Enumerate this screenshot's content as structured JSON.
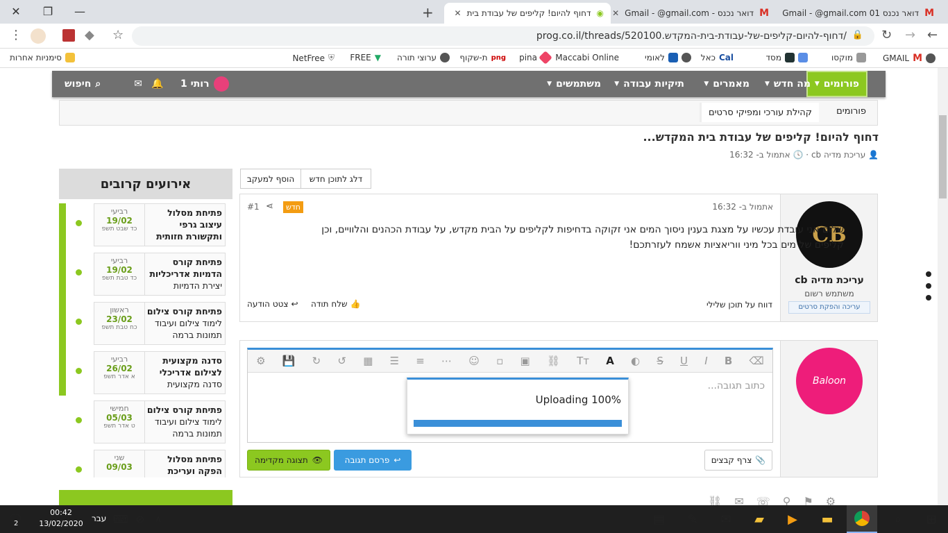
{
  "browser": {
    "tabs": [
      {
        "title": "דחוף להיום! קליפים של עבודת בית",
        "active": true
      },
      {
        "title": "דואר נכנס - Gmail - @gmail.com",
        "active": false
      },
      {
        "title": "דואר נכנס Gmail - @gmail.com 01",
        "active": false
      }
    ],
    "url": "prog.co.il/threads/520100.דחוף-להיום-קליפים-של-עבודת-בית-המקדש/",
    "bookmarks": [
      "GMAIL",
      "מוקסו",
      "מסד",
      "כאל",
      "לאומי",
      "Maccabi Online",
      "pina",
      "ת-שקוף",
      "ערוצי תורה",
      "FREE",
      "NetFree",
      "סימניות אחרות"
    ]
  },
  "nav": {
    "items": [
      "פורומים",
      "מה חדש",
      "מאמרים",
      "תיקיות עבודה",
      "משתמשים"
    ],
    "user": "רותי 1",
    "search": "חיפוש"
  },
  "breadcrumb": [
    "פורומים",
    "קהילת עורכי ומפיקי סרטים"
  ],
  "thread": {
    "title": "דחוף להיום! קליפים של עבודת בית המקדש...",
    "author": "עריכת מדיה cb",
    "time": "אתמול ב- 16:32",
    "btn_watch": "הוסף למעקב",
    "btn_new": "דלג לתוכן חדש"
  },
  "post": {
    "username": "עריכת מדיה cb",
    "usertitle": "משתמש רשום",
    "userbanner": "עריכה והפקת סרטים",
    "time": "אתמול ב- 16:32",
    "badge": "חדש",
    "number": "#1",
    "body": "שלום אני עובדת עכשיו על מצגת בענין ניסוך המים אני זקוקה בדחיפות לקליפים על הבית מקדש, על עבודת הכהנים והלוויים, וכן קליפים של מים בכל מיני ווריאציות אשמח לעזרתכם!",
    "report": "דווח על תוכן שלילי",
    "thanks": "שלח תודה",
    "quote": "צטט הודעה"
  },
  "reply": {
    "placeholder": "כתוב תגובה...",
    "upload": "Uploading 100%",
    "upload_progress": 1.0,
    "attach": "צרף קבצים",
    "submit": "פרסם תגובה",
    "preview": "תצוגה מקדימה"
  },
  "events": {
    "title": "אירועים קרובים",
    "list": [
      {
        "title": "פתיחת מסלול עיצוב גרפי ותקשורת חזותית",
        "sub": "",
        "day": "רביעי",
        "date": "19/02",
        "heb": "כד שבט תשפ"
      },
      {
        "title": "פתיחת קורס הדמיות אדריכליות",
        "sub": "יצירת הדמיות",
        "day": "רביעי",
        "date": "19/02",
        "heb": "כד טבת תשפ"
      },
      {
        "title": "פתיחת קורס צילום",
        "sub": "לימוד צילום ועיבוד תמונות ברמה",
        "day": "ראשון",
        "date": "23/02",
        "heb": "כח טבת תשפ"
      },
      {
        "title": "סדנה מקצועית לצילום אדריכלי",
        "sub": "סדנה מקצועית",
        "day": "רביעי",
        "date": "26/02",
        "heb": "א אדר תשפ"
      },
      {
        "title": "פתיחת קורס צילום",
        "sub": "לימוד צילום ועיבוד תמונות ברמה",
        "day": "חמישי",
        "date": "05/03",
        "heb": "ט אדר תשפ"
      },
      {
        "title": "פתיחת מסלול הפקה ועריכת",
        "sub": "",
        "day": "שני",
        "date": "09/03",
        "heb": ""
      }
    ]
  },
  "taskbar": {
    "time": "00:42",
    "date": "13/02/2020",
    "lang": "עבר",
    "notif": "2"
  }
}
